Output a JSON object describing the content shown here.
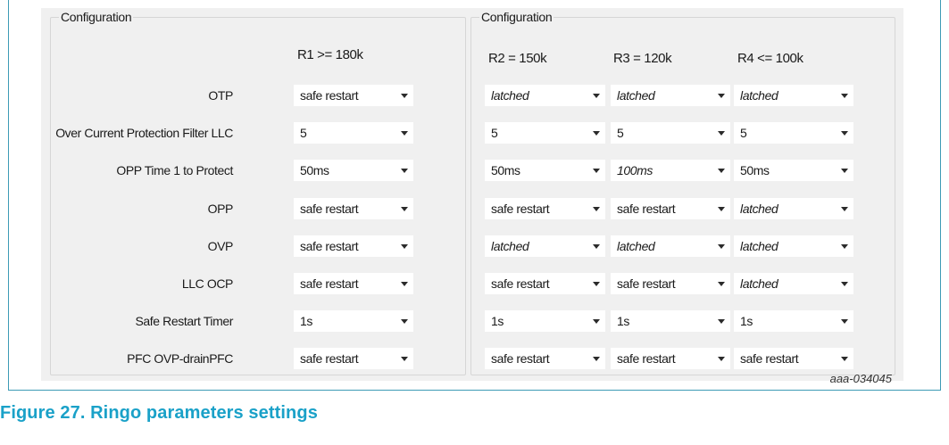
{
  "left_group": {
    "title": "Configuration",
    "column_header": "R1 >= 180k"
  },
  "right_group": {
    "title": "Configuration",
    "column_headers": [
      "R2 = 150k",
      "R3 = 120k",
      "R4 <= 100k"
    ]
  },
  "rows": [
    {
      "label": "OTP",
      "values": [
        "safe restart",
        "latched",
        "latched",
        "latched"
      ],
      "italic": [
        false,
        true,
        true,
        true
      ]
    },
    {
      "label": "Over Current Protection Filter LLC",
      "values": [
        "5",
        "5",
        "5",
        "5"
      ],
      "italic": [
        false,
        false,
        false,
        false
      ]
    },
    {
      "label": "OPP Time 1 to Protect",
      "values": [
        "50ms",
        "50ms",
        "100ms",
        "50ms"
      ],
      "italic": [
        false,
        false,
        true,
        false
      ]
    },
    {
      "label": "OPP",
      "values": [
        "safe restart",
        "safe restart",
        "safe restart",
        "latched"
      ],
      "italic": [
        false,
        false,
        false,
        true
      ]
    },
    {
      "label": "OVP",
      "values": [
        "safe restart",
        "latched",
        "latched",
        "latched"
      ],
      "italic": [
        false,
        true,
        true,
        true
      ]
    },
    {
      "label": "LLC OCP",
      "values": [
        "safe restart",
        "safe restart",
        "safe restart",
        "latched"
      ],
      "italic": [
        false,
        false,
        false,
        true
      ]
    },
    {
      "label": "Safe Restart Timer",
      "values": [
        "1s",
        "1s",
        "1s",
        "1s"
      ],
      "italic": [
        false,
        false,
        false,
        false
      ]
    },
    {
      "label": "PFC OVP-drainPFC",
      "values": [
        "safe restart",
        "safe restart",
        "safe restart",
        "safe restart"
      ],
      "italic": [
        false,
        false,
        false,
        false
      ]
    }
  ],
  "figure_id": "aaa-034045",
  "caption": "Figure 27.  Ringo parameters settings",
  "colors": {
    "caption": "#1aa1c8",
    "frame": "#3d9bb5",
    "panel": "#f0f0f0"
  }
}
